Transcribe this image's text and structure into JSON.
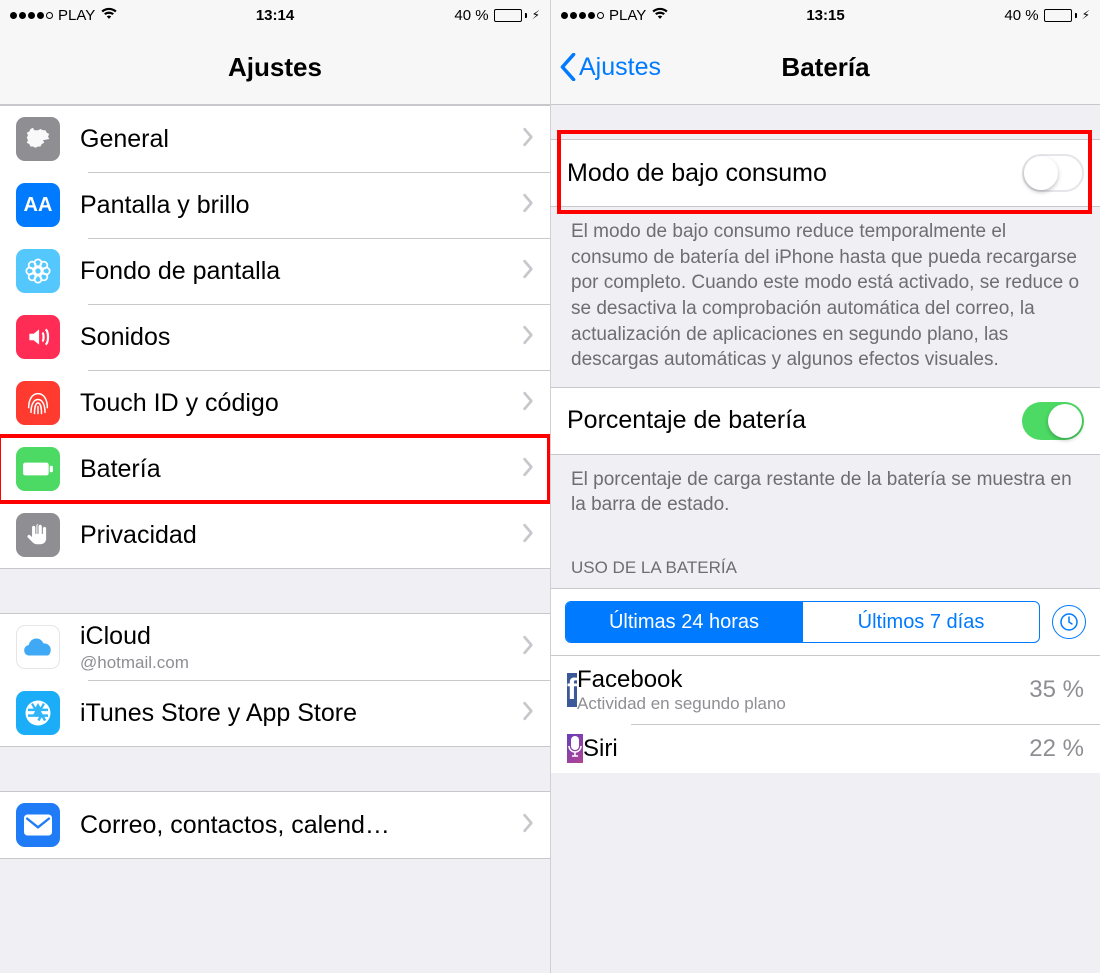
{
  "left": {
    "status": {
      "carrier": "PLAY",
      "time": "13:14",
      "battery_pct": "40 %"
    },
    "nav_title": "Ajustes",
    "rows": [
      {
        "label": "General",
        "icon": "gear",
        "bg": "#8e8e93"
      },
      {
        "label": "Pantalla y brillo",
        "icon": "aa",
        "bg": "#007aff"
      },
      {
        "label": "Fondo de pantalla",
        "icon": "flower",
        "bg": "#54c7fc"
      },
      {
        "label": "Sonidos",
        "icon": "speaker",
        "bg": "#ff2d55"
      },
      {
        "label": "Touch ID y código",
        "icon": "fingerprint",
        "bg": "#ff3b30"
      },
      {
        "label": "Batería",
        "icon": "battery",
        "bg": "#4cd964"
      },
      {
        "label": "Privacidad",
        "icon": "hand",
        "bg": "#8e8e93"
      }
    ],
    "rows2": [
      {
        "label": "iCloud",
        "sub": "@hotmail.com",
        "icon": "icloud",
        "bg": "#ffffff"
      },
      {
        "label": "iTunes Store y App Store",
        "icon": "appstore",
        "bg": "#1badf8"
      }
    ],
    "rows3": [
      {
        "label": "Correo, contactos, calend…",
        "icon": "mail",
        "bg": "#1f7cf6"
      }
    ],
    "highlight_index": 5
  },
  "right": {
    "status": {
      "carrier": "PLAY",
      "time": "13:15",
      "battery_pct": "40 %"
    },
    "back_label": "Ajustes",
    "nav_title": "Batería",
    "low_power": {
      "label": "Modo de bajo consumo",
      "on": false
    },
    "low_power_footer": "El modo de bajo consumo reduce temporalmente el consumo de batería del iPhone hasta que pueda recargarse por completo. Cuando este modo está activado, se reduce o se desactiva la comprobación automática del correo, la actualización de aplicaciones en segundo plano, las descargas automáticas y algunos efectos visuales.",
    "pct_row": {
      "label": "Porcentaje de batería",
      "on": true
    },
    "pct_footer": "El porcentaje de carga restante de la batería se muestra en la barra de estado.",
    "usage_header": "USO DE LA BATERÍA",
    "seg": {
      "a": "Últimas 24 horas",
      "b": "Últimos 7 días"
    },
    "usage": [
      {
        "name": "Facebook",
        "sub": "Actividad en segundo plano",
        "pct": "35 %",
        "bg": "#3b5998"
      },
      {
        "name": "Siri",
        "sub": "",
        "pct": "22 %",
        "bg": "#8e44ad"
      }
    ]
  }
}
